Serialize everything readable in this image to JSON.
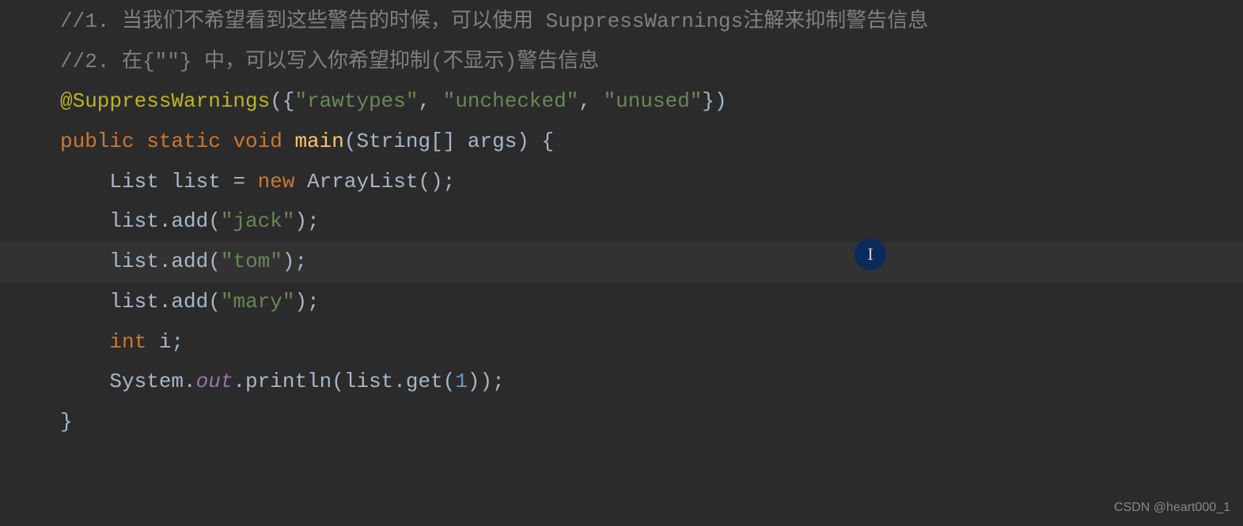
{
  "code": {
    "line1": {
      "comment": "//1. 当我们不希望看到这些警告的时候，可以使用 SuppressWarnings注解来抑制警告信息"
    },
    "line2": {
      "comment": "//2. 在{\"\"} 中，可以写入你希望抑制(不显示)警告信息"
    },
    "line3": {
      "annotation": "@SuppressWarnings",
      "paren_open": "({",
      "str1": "\"rawtypes\"",
      "comma1": ", ",
      "str2": "\"unchecked\"",
      "comma2": ", ",
      "str3": "\"unused\"",
      "paren_close": "})"
    },
    "line4": {
      "kw_public": "public ",
      "kw_static": "static ",
      "kw_void": "void ",
      "method": "main",
      "params": "(String[] args) {"
    },
    "line5": {
      "indent": "    ",
      "type": "List list = ",
      "kw_new": "new ",
      "ctor": "ArrayList();"
    },
    "line6": {
      "indent": "    ",
      "call": "list.add(",
      "str": "\"jack\"",
      "end": ");"
    },
    "line7": {
      "indent": "    ",
      "call": "list.add(",
      "str": "\"tom\"",
      "end": ");"
    },
    "line8": {
      "indent": "    ",
      "call": "list.add(",
      "str": "\"mary\"",
      "end": ");"
    },
    "line9": {
      "indent": "    ",
      "kw_int": "int ",
      "var": "i;"
    },
    "line10": {
      "indent": "    ",
      "sys": "System.",
      "out": "out",
      "println": ".println(list.get(",
      "num": "1",
      "end": "));"
    },
    "line11": {
      "blank": ""
    },
    "line12": {
      "brace": "}"
    }
  },
  "watermark": "CSDN @heart000_1"
}
